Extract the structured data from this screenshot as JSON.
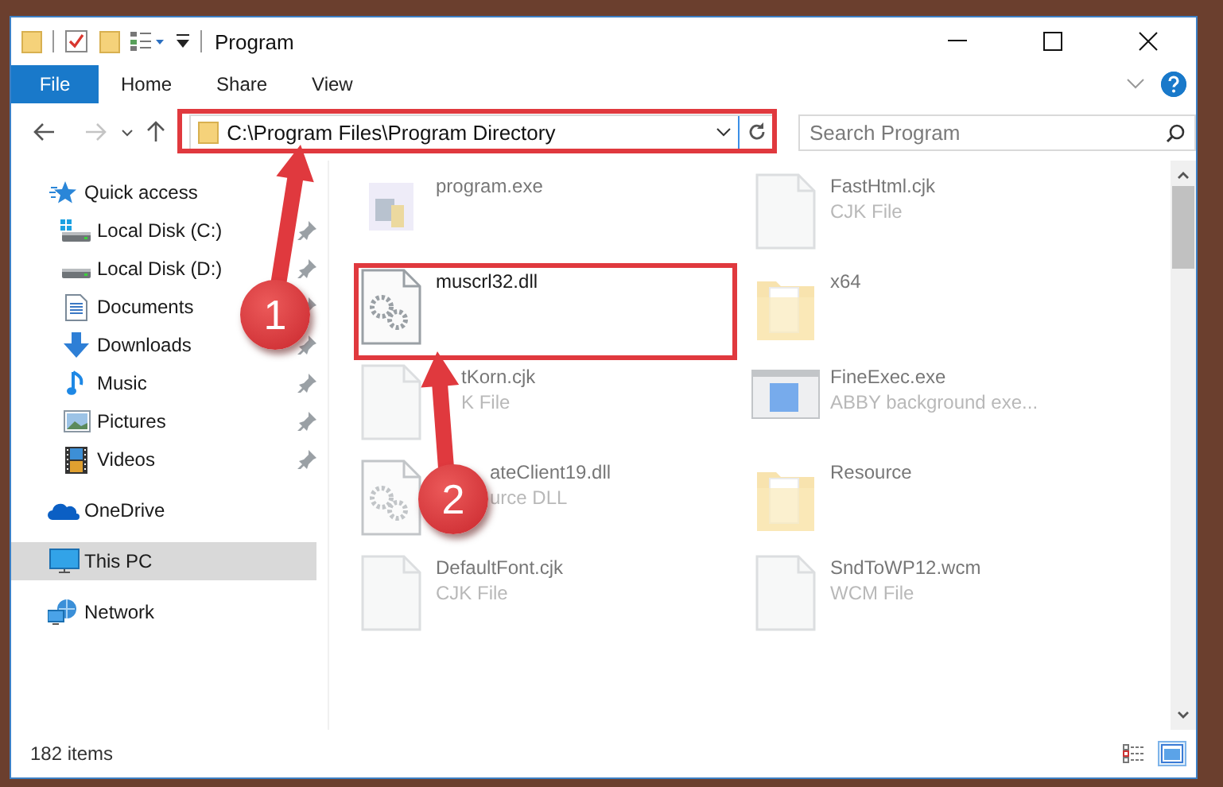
{
  "window": {
    "title": "Program"
  },
  "ribbon": {
    "tabs": [
      {
        "label": "File",
        "kind": "file"
      },
      {
        "label": "Home",
        "kind": "tab"
      },
      {
        "label": "Share",
        "kind": "tab"
      },
      {
        "label": "View",
        "kind": "tab"
      }
    ]
  },
  "address": {
    "path": "C:\\Program Files\\Program Directory"
  },
  "search": {
    "placeholder": "Search Program"
  },
  "sidebar": {
    "items": [
      {
        "label": "Quick access",
        "selected": false,
        "children": [
          {
            "label": "Local Disk (C:)",
            "pinned": true,
            "selected": false
          },
          {
            "label": "Local Disk (D:)",
            "pinned": true,
            "selected": false
          },
          {
            "label": "Documents",
            "pinned": true,
            "selected": false
          },
          {
            "label": "Downloads",
            "pinned": true,
            "selected": false
          },
          {
            "label": "Music",
            "pinned": true,
            "selected": false
          },
          {
            "label": "Pictures",
            "pinned": true,
            "selected": false
          },
          {
            "label": "Videos",
            "pinned": true,
            "selected": false
          }
        ]
      },
      {
        "label": "OneDrive",
        "selected": false
      },
      {
        "label": "This PC",
        "selected": true
      },
      {
        "label": "Network",
        "selected": false
      }
    ]
  },
  "files": [
    {
      "name": "program.exe",
      "blurred": true
    },
    {
      "name": "FastHtml.cjk",
      "type": "CJK File",
      "blurred": true
    },
    {
      "name": "muscrl32.dll",
      "blurred": false
    },
    {
      "name": "x64",
      "blurred": true
    },
    {
      "name": "tKorn.cjk",
      "type": "K File",
      "blurred": true
    },
    {
      "name": "FineExec.exe",
      "type": "ABBY background exe...",
      "blurred": true
    },
    {
      "name": "ateClient19.dll",
      "type": "urce DLL",
      "blurred": true
    },
    {
      "name": "Resource",
      "blurred": true
    },
    {
      "name": "DefaultFont.cjk",
      "type": "CJK File",
      "blurred": true
    },
    {
      "name": "SndToWP12.wcm",
      "type": "WCM File",
      "blurred": true
    }
  ],
  "annotations": [
    {
      "number": "1"
    },
    {
      "number": "2"
    }
  ],
  "status_bar": {
    "count": "182 items",
    "views": [
      {
        "kind": "details",
        "selected": false
      },
      {
        "kind": "large-icons",
        "selected": true
      }
    ]
  }
}
